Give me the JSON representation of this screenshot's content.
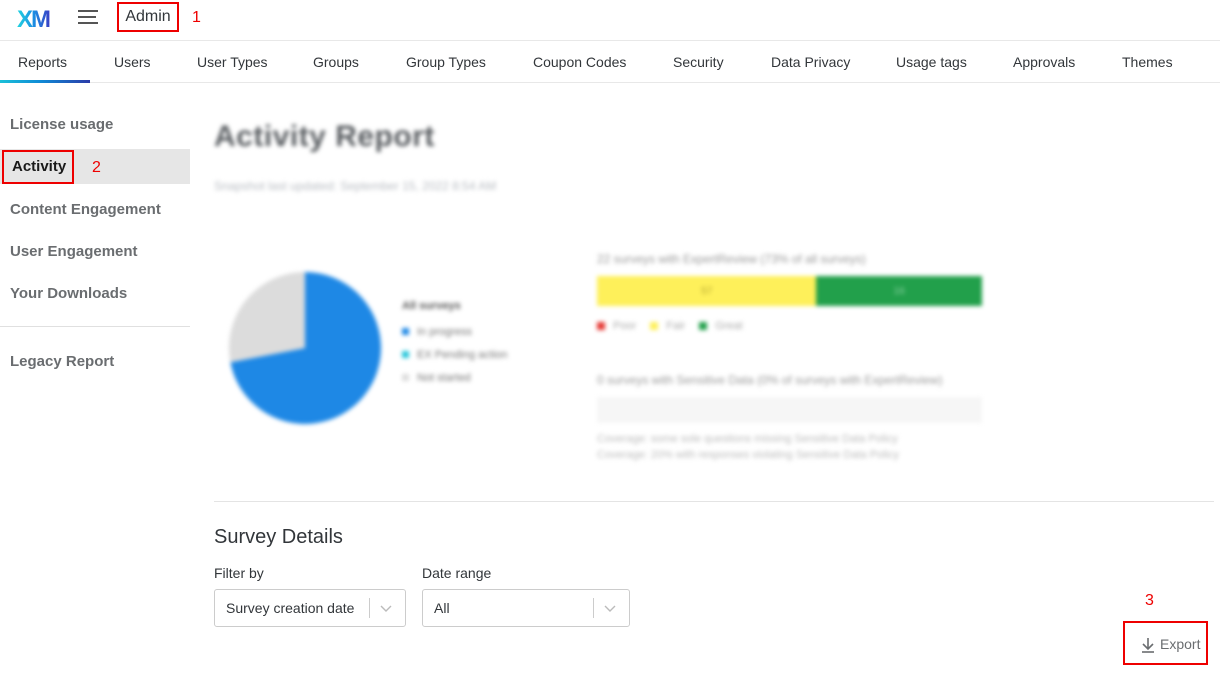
{
  "header": {
    "logo_text": "XM",
    "admin_label": "Admin",
    "annotation_1": "1"
  },
  "tabs": [
    {
      "label": "Reports",
      "active": true
    },
    {
      "label": "Users"
    },
    {
      "label": "User Types"
    },
    {
      "label": "Groups"
    },
    {
      "label": "Group Types"
    },
    {
      "label": "Coupon Codes"
    },
    {
      "label": "Security"
    },
    {
      "label": "Data Privacy"
    },
    {
      "label": "Usage tags"
    },
    {
      "label": "Approvals"
    },
    {
      "label": "Themes"
    }
  ],
  "sidebar": {
    "items": [
      {
        "label": "License usage"
      },
      {
        "label": "Activity",
        "active": true
      },
      {
        "label": "Content Engagement"
      },
      {
        "label": "User Engagement"
      },
      {
        "label": "Your Downloads"
      },
      {
        "label": "Legacy Report"
      }
    ],
    "annotation_2": "2"
  },
  "report": {
    "title": "Activity Report",
    "subtitle": "Snapshot last updated: September 15, 2022 8:54 AM",
    "pie": {
      "title": "All surveys",
      "colors": [
        "#1e88e5",
        "#26c6da",
        "#dcdcdc"
      ],
      "slices": [
        {
          "label": "In progress",
          "value": 72
        },
        {
          "label": "EX Pending action",
          "value": 0
        },
        {
          "label": "Not started",
          "value": 28
        }
      ]
    },
    "expert_review": {
      "title": "22 surveys with ExpertReview (73% of all surveys)",
      "segments": [
        {
          "label": "Poor",
          "value": 0,
          "color": "#e53935"
        },
        {
          "label": "Fair",
          "value": 57,
          "display": "57",
          "color": "#fef05a"
        },
        {
          "label": "Great",
          "value": 43,
          "display": "16",
          "color": "#22a04b"
        }
      ]
    },
    "sensitive": {
      "title": "0 surveys with Sensitive Data (0% of surveys with ExpertReview)",
      "note_1": "Coverage: some sole questions missing Sensitive Data Policy",
      "note_2": "Coverage: 20% with responses violating Sensitive Data Policy"
    }
  },
  "survey_details": {
    "title": "Survey Details",
    "filter_label": "Filter by",
    "filter_value": "Survey creation date",
    "date_label": "Date range",
    "date_value": "All",
    "export_label": "Export",
    "annotation_3": "3"
  },
  "colors": {
    "annotation_red": "#e00000",
    "accent_blue": "#1e88e5"
  }
}
